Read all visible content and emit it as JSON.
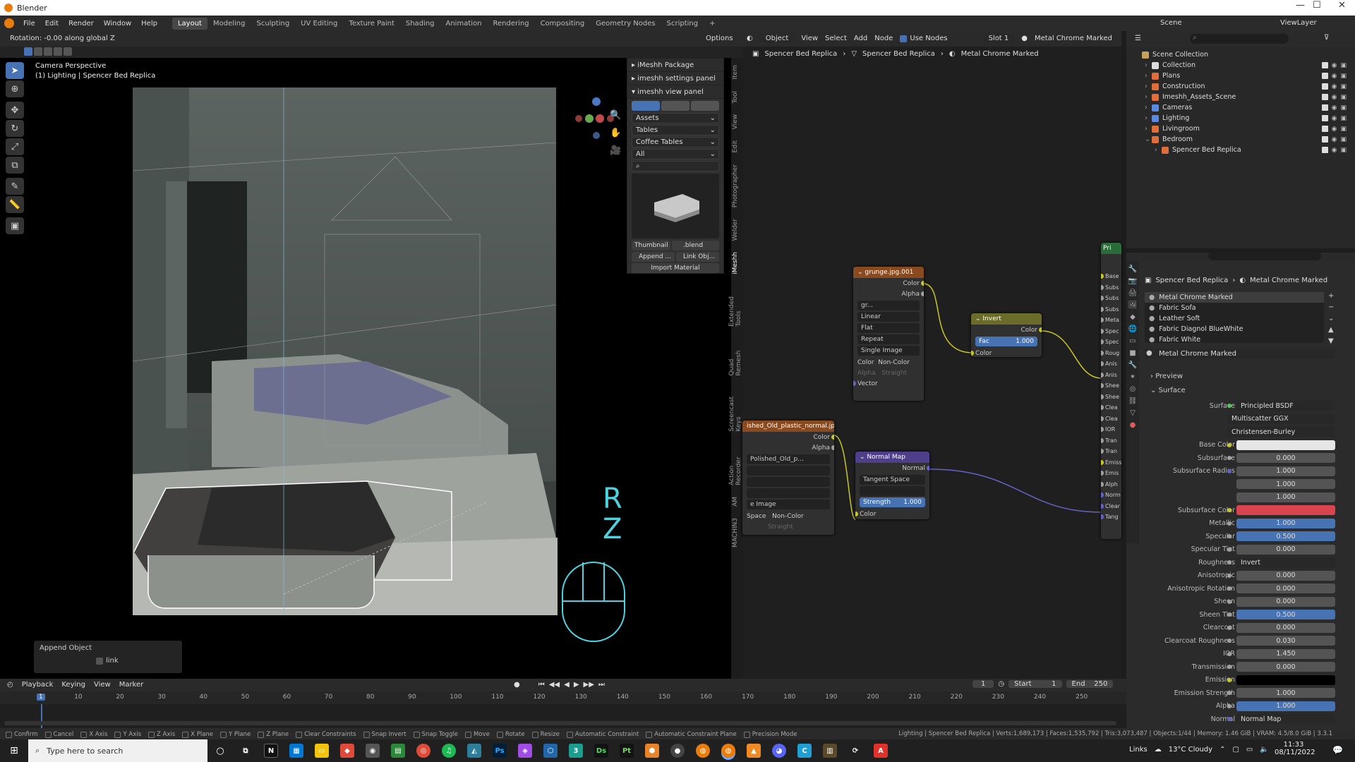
{
  "window": {
    "title": "Blender",
    "min": "—",
    "max": "☐",
    "close": "✕"
  },
  "menu": {
    "items": [
      "File",
      "Edit",
      "Render",
      "Window",
      "Help"
    ],
    "workspaces": [
      "Layout",
      "Modeling",
      "Sculpting",
      "UV Editing",
      "Texture Paint",
      "Shading",
      "Animation",
      "Rendering",
      "Compositing",
      "Geometry Nodes",
      "Scripting",
      "+"
    ],
    "active_workspace": "Layout",
    "scene": "Scene",
    "view_layer": "ViewLayer"
  },
  "viewport": {
    "header_text": "Rotation: -0.00 along global Z",
    "options": "Options",
    "overlay_title": "Camera Perspective",
    "overlay_subtitle": "(1) Lighting | Spencer Bed Replica",
    "key_r": "R",
    "key_z": "Z",
    "append_object_label": "Append Object",
    "link_label": "link"
  },
  "imeshh": {
    "package": "iMeshh Package",
    "settings": "imeshh settings panel",
    "view": "imeshh view panel",
    "dropdowns": [
      "Assets",
      "Tables",
      "Coffee Tables",
      "All"
    ],
    "thumbnail": "Thumbnail",
    "blend": ".blend",
    "append": "Append ...",
    "link_obj": "Link Obj...",
    "import_material": "Import Material"
  },
  "side_tabs": [
    "Item",
    "Tool",
    "View",
    "Edit",
    "Photographer",
    "Welder",
    "iMeshh",
    "Extended Tools",
    "Quad Remesh",
    "Screencast Keys",
    "Action Recorder",
    "AM",
    "MACHIN3"
  ],
  "node_editor": {
    "header": {
      "mode": "Object",
      "view": "View",
      "select": "Select",
      "add": "Add",
      "node": "Node",
      "use_nodes": "Use Nodes",
      "slot": "Slot 1",
      "material": "Metal Chrome Marked"
    },
    "breadcrumb": [
      "Spencer Bed Replica",
      "Spencer Bed Replica",
      "Metal Chrome Marked"
    ],
    "grunge": {
      "title": "grunge.jpg.001",
      "out_color": "Color",
      "out_alpha": "Alpha",
      "img": "gr...",
      "interp": "Linear",
      "proj": "Flat",
      "ext": "Repeat",
      "source": "Single Image",
      "cs_label": "Color",
      "cs_value": "Non-Color",
      "alpha_label": "Alpha",
      "alpha_value": "Straight",
      "vector": "Vector"
    },
    "invert": {
      "title": "Invert",
      "out": "Color",
      "fac_label": "Fac",
      "fac_value": "1.000",
      "in_color": "Color"
    },
    "plastic": {
      "title": "ished_Old_plastic_normal.jpg",
      "out_color": "Color",
      "out_alpha": "Alpha",
      "img": "Polished_Old_p...",
      "source": "e Image",
      "cs_label": "Space",
      "cs_value": "Non-Color",
      "alpha_value": "Straight"
    },
    "normalmap": {
      "title": "Normal Map",
      "out": "Normal",
      "space": "Tangent Space",
      "strength_label": "Strength",
      "strength_value": "1.000",
      "in_color": "Color"
    },
    "bsdf_inputs": [
      "Base",
      "Subs",
      "Subs",
      "Subs",
      "Meta",
      "Spec",
      "Spec",
      "Roug",
      "Anis",
      "Anis",
      "Shee",
      "Shee",
      "Clea",
      "Clea",
      "IOR",
      "Tran",
      "Tran",
      "Emiss",
      "Emis",
      "Alph",
      "Norm",
      "Clear",
      "Tang"
    ],
    "bsdf_title": "Pri"
  },
  "outliner": {
    "items": [
      {
        "label": "Scene Collection",
        "depth": 0
      },
      {
        "label": "Collection",
        "depth": 1
      },
      {
        "label": "Plans",
        "depth": 1
      },
      {
        "label": "Construction",
        "depth": 1
      },
      {
        "label": "Imeshh_Assets_Scene",
        "depth": 1
      },
      {
        "label": "Cameras",
        "depth": 1
      },
      {
        "label": "Lighting",
        "depth": 1
      },
      {
        "label": "Livingroom",
        "depth": 1
      },
      {
        "label": "Bedroom",
        "depth": 1
      },
      {
        "label": "Spencer Bed Replica",
        "depth": 2
      }
    ]
  },
  "properties": {
    "breadcrumb_object": "Spencer Bed Replica",
    "breadcrumb_material": "Metal Chrome Marked",
    "materials": [
      "Metal Chrome Marked",
      "Fabric Sofa",
      "Leather Soft",
      "Fabric Diagnol BlueWhite",
      "Fabric White"
    ],
    "material_name": "Metal Chrome Marked",
    "preview": "Preview",
    "surface_section": "Surface",
    "surface_label": "Surface",
    "surface_value": "Principled BSDF",
    "distribution": "Multiscatter GGX",
    "subsurface_method": "Christensen-Burley",
    "rows": [
      {
        "label": "Base Color",
        "value": "",
        "kind": "color",
        "color": "#e6e6e6",
        "dot": "#c7c729"
      },
      {
        "label": "Subsurface",
        "value": "0.000",
        "kind": "num",
        "dot": "#a1a1a1"
      },
      {
        "label": "Subsurface Radius",
        "value": "1.000",
        "kind": "num",
        "dot": "#6363c7"
      },
      {
        "label": "",
        "value": "1.000",
        "kind": "num",
        "dot": ""
      },
      {
        "label": "",
        "value": "1.000",
        "kind": "num",
        "dot": ""
      },
      {
        "label": "Subsurface Color",
        "value": "",
        "kind": "color",
        "color": "#d9444e",
        "dot": "#c7c729"
      },
      {
        "label": "Metallic",
        "value": "1.000",
        "kind": "blue",
        "dot": "#a1a1a1"
      },
      {
        "label": "Specular",
        "value": "0.500",
        "kind": "blue",
        "dot": "#a1a1a1"
      },
      {
        "label": "Specular Tint",
        "value": "0.000",
        "kind": "num",
        "dot": "#a1a1a1"
      },
      {
        "label": "Roughness",
        "value": "Invert",
        "kind": "link",
        "dot": "#a1a1a1"
      },
      {
        "label": "Anisotropic",
        "value": "0.000",
        "kind": "num",
        "dot": "#a1a1a1"
      },
      {
        "label": "Anisotropic Rotation",
        "value": "0.000",
        "kind": "num",
        "dot": "#a1a1a1"
      },
      {
        "label": "Sheen",
        "value": "0.000",
        "kind": "num",
        "dot": "#a1a1a1"
      },
      {
        "label": "Sheen Tint",
        "value": "0.500",
        "kind": "blue",
        "dot": "#a1a1a1"
      },
      {
        "label": "Clearcoat",
        "value": "0.000",
        "kind": "num",
        "dot": "#a1a1a1"
      },
      {
        "label": "Clearcoat Roughness",
        "value": "0.030",
        "kind": "num",
        "dot": "#a1a1a1"
      },
      {
        "label": "IOR",
        "value": "1.450",
        "kind": "num",
        "dot": "#a1a1a1"
      },
      {
        "label": "Transmission",
        "value": "0.000",
        "kind": "num",
        "dot": "#a1a1a1"
      },
      {
        "label": "Emission",
        "value": "",
        "kind": "color",
        "color": "#000000",
        "dot": "#c7c729"
      },
      {
        "label": "Emission Strength",
        "value": "1.000",
        "kind": "num",
        "dot": "#a1a1a1"
      },
      {
        "label": "Alpha",
        "value": "1.000",
        "kind": "blue",
        "dot": "#a1a1a1"
      },
      {
        "label": "Normal",
        "value": "Normal Map",
        "kind": "link",
        "dot": "#6363c7"
      }
    ]
  },
  "timeline": {
    "playback": "Playback",
    "keying": "Keying",
    "view": "View",
    "marker": "Marker",
    "current_frame": "1",
    "start_label": "Start",
    "start": "1",
    "end_label": "End",
    "end": "250",
    "ticks": [
      "1",
      "10",
      "20",
      "30",
      "40",
      "50",
      "60",
      "70",
      "80",
      "90",
      "100",
      "110",
      "120",
      "130",
      "140",
      "150",
      "160",
      "170",
      "180",
      "190",
      "200",
      "210",
      "220",
      "230",
      "240",
      "250"
    ]
  },
  "status": {
    "items": [
      "Confirm",
      "Cancel",
      "X Axis",
      "Y Axis",
      "Z Axis",
      "X Plane",
      "Y Plane",
      "Z Plane",
      "Clear Constraints",
      "Snap Invert",
      "Snap Toggle",
      "Move",
      "Rotate",
      "Resize",
      "Automatic Constraint",
      "Automatic Constraint Plane",
      "Precision Mode"
    ],
    "stats": "Lighting | Spencer Bed Replica | Verts:1,689,173 | Faces:1,535,792 | Tris:3,073,487 | Objects:1/44 | Memory: 1.46 GiB | VRAM: 4.5/8.0 GiB | 3.3.1"
  },
  "taskbar": {
    "search": "Type here to search",
    "links": "Links",
    "weather": "13°C  Cloudy",
    "time": "11:33",
    "date": "08/11/2022"
  }
}
